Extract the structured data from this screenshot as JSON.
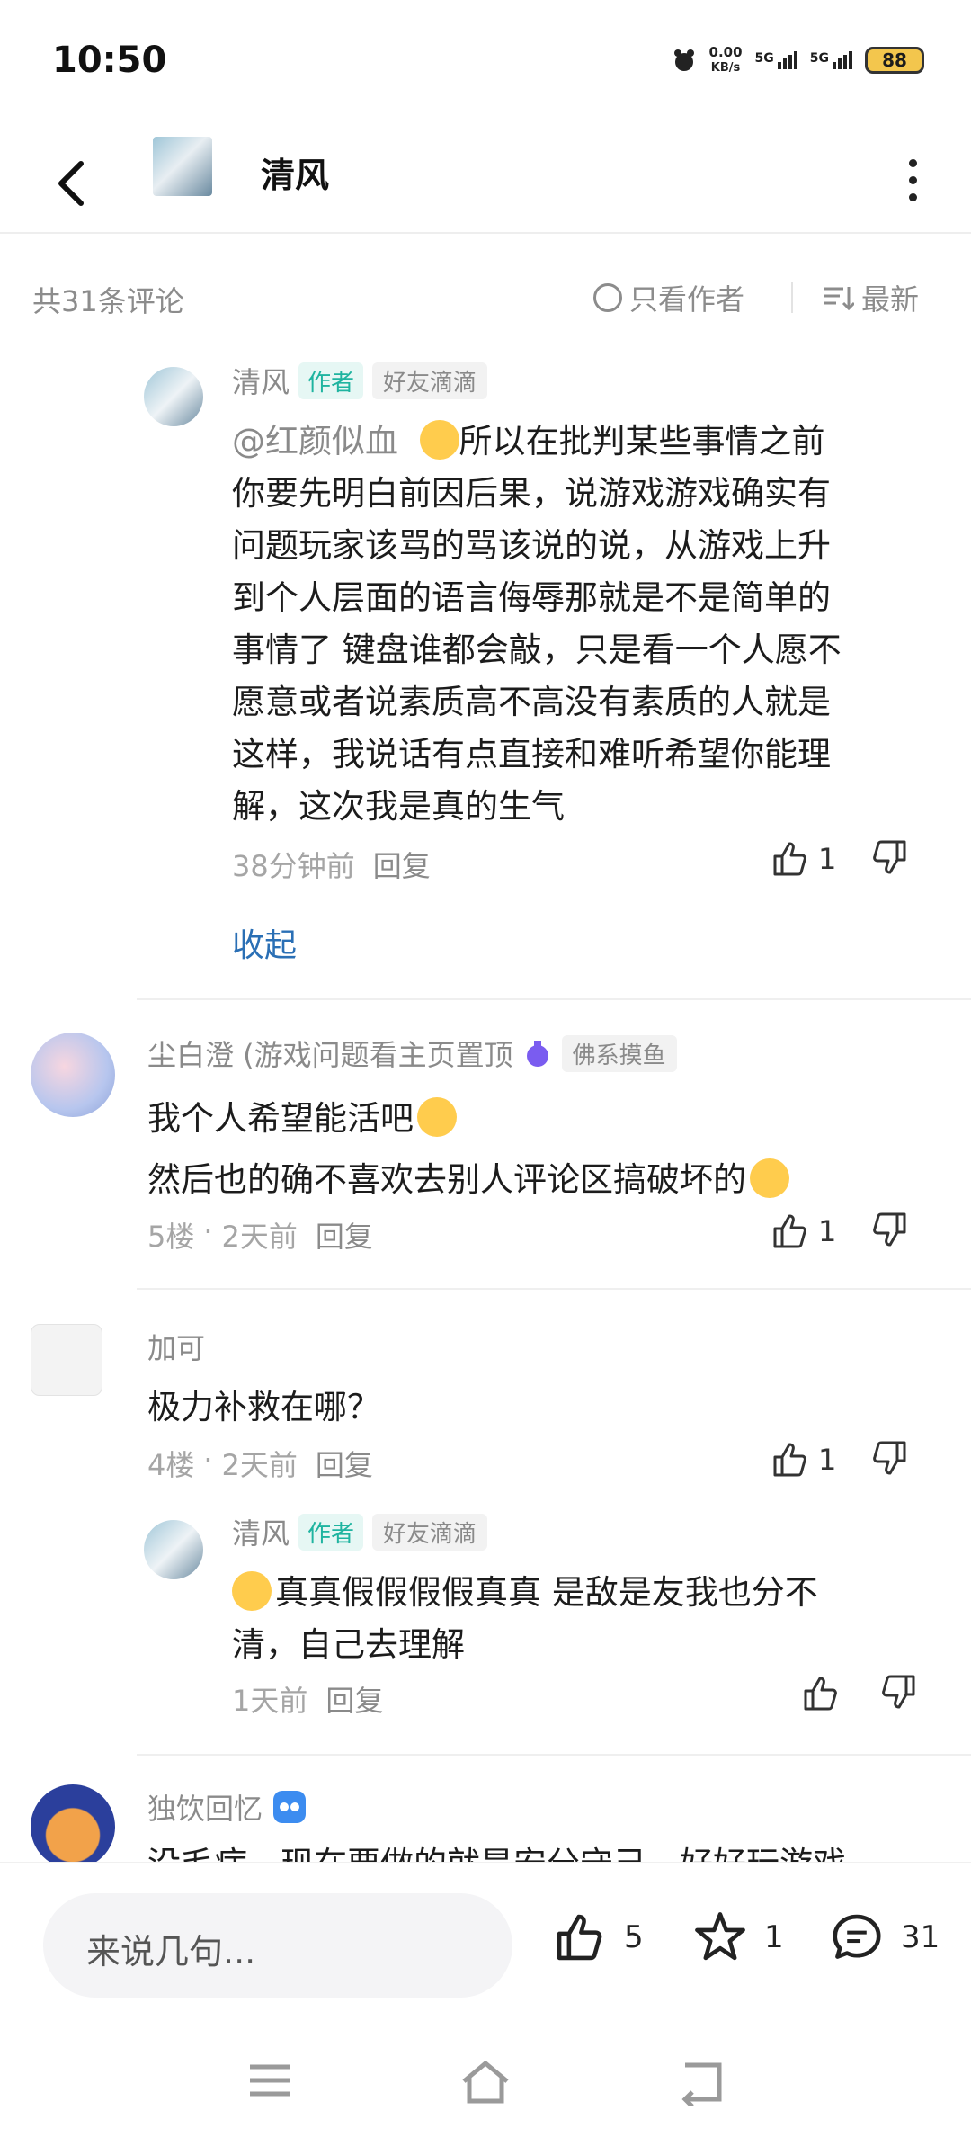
{
  "status_bar": {
    "time": "10:50",
    "net_speed_value": "0.00",
    "net_speed_unit": "KB/s",
    "sim1": "5G",
    "sim2": "5G",
    "battery": "88"
  },
  "header": {
    "title": "清风",
    "back_icon": "chevron-left-icon",
    "more_icon": "more-vertical-icon"
  },
  "filter": {
    "count_label": "共31条评论",
    "only_author": "只看作者",
    "sort_label": "最新"
  },
  "comments": [
    {
      "username": "清风",
      "tag_author": "作者",
      "tag_friend": "好友滴滴",
      "mention": "@红颜似血",
      "lines": [
        "所以在批判某些事情之前",
        "你要先明白前因后果，说游戏游戏确实有",
        "问题玩家该骂的骂该说的说，从游戏上升",
        "到个人层面的语言侮辱那就是不是简单的",
        "事情了 键盘谁都会敲，只是看一个人愿不",
        "愿意或者说素质高不高没有素质的人就是",
        "这样，我说话有点直接和难听希望你能理",
        "解，这次我是真的生气"
      ],
      "time": "38分钟前",
      "reply": "回复",
      "likes": "1",
      "collapse": "收起"
    },
    {
      "username": "尘白澄 (游戏问题看主页置顶",
      "tag_grey": "佛系摸鱼",
      "lines": [
        "我个人希望能活吧",
        "然后也的确不喜欢去别人评论区搞破坏的"
      ],
      "floor": "5楼",
      "dot": "·",
      "time": "2天前",
      "reply": "回复",
      "likes": "1"
    },
    {
      "username": "加可",
      "lines": [
        "极力补救在哪？"
      ],
      "floor": "4楼",
      "dot": "·",
      "time": "2天前",
      "reply": "回复",
      "likes": "1"
    },
    {
      "username": "清风",
      "tag_author": "作者",
      "tag_friend": "好友滴滴",
      "lines": [
        "真真假假假假真真 是敌是友我也分不",
        "清，自己去理解"
      ],
      "time": "1天前",
      "reply": "回复"
    },
    {
      "username": "独饮回忆",
      "lines": [
        "没毛病，现在要做的就是安分守己，好好玩游戏"
      ]
    }
  ],
  "bottom": {
    "input_placeholder": "来说几句...",
    "likes": "5",
    "favorites": "1",
    "comments": "31"
  },
  "colors": {
    "accent_teal": "#1fb4a0",
    "link_blue": "#2a6fb5",
    "battery": "#f3c64d"
  }
}
